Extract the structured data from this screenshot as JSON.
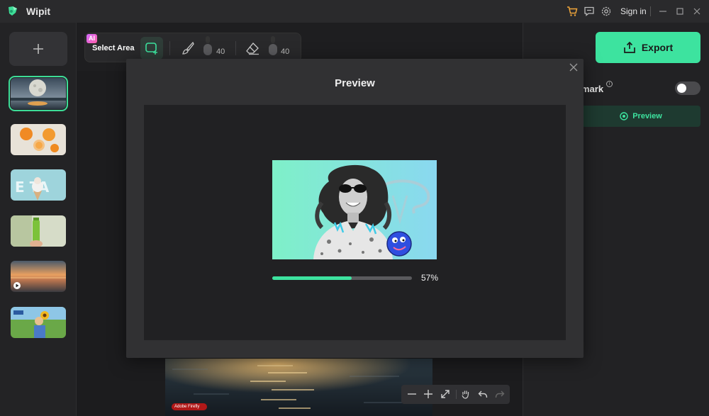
{
  "app": {
    "title": "Wipit"
  },
  "titlebar": {
    "signin_label": "Sign in"
  },
  "toolbar": {
    "ai_badge": "AI",
    "select_area_label": "Select Area",
    "brush_size": "40",
    "eraser_size": "40"
  },
  "right_panel": {
    "export_label": "Export",
    "watermark_label": "mark",
    "watermark_enabled": false,
    "preview_label": "Preview"
  },
  "canvas": {
    "firefly_badge": "Adobe Firefly"
  },
  "modal": {
    "title": "Preview",
    "progress_percent": 57,
    "progress_text": "57%"
  },
  "colors": {
    "accent": "#3de39f",
    "background": "#1e1e20",
    "modal": "#313133"
  }
}
